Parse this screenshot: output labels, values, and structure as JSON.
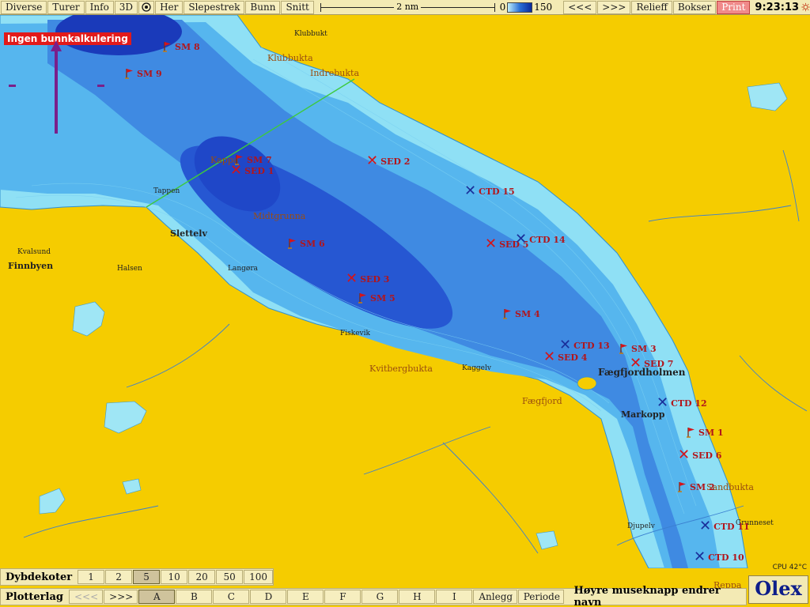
{
  "toolbar": {
    "buttons": [
      "Diverse",
      "Turer",
      "Info",
      "3D",
      "Her",
      "Slepestrek",
      "Bunn",
      "Snitt"
    ],
    "scale_label": "2 nm",
    "depth_min": "0",
    "depth_max": "150",
    "right_buttons": [
      "<<<",
      ">>>",
      "Relieff",
      "Bokser",
      "Print"
    ],
    "clock": "9:23:13"
  },
  "warning": "Ingen bunnkalkulering",
  "places": {
    "klubbukt": "Klubbukt",
    "klubbukta": "Klubbukta",
    "indrebukta": "Indrebukta",
    "tappen": "Tappen",
    "slettelv": "Slettelv",
    "kvalsund": "Kvalsund",
    "finnbyen": "Finnbyen",
    "halsen": "Halsen",
    "langora": "Langøra",
    "fiskevik": "Fiskevik",
    "kvitbergbukta": "Kvitbergbukta",
    "kaggelv": "Kaggelv",
    "faegfjord": "Fægfjord",
    "faegfjordholmen": "Fægfjordholmen",
    "markopp": "Markopp",
    "djupelv": "Djupelv",
    "sandbukta": "Sandbukta",
    "grunneset": "Grunneset",
    "reppa": "Reppa",
    "kappa": "Kappa",
    "midtgrunna": "Midtgrunna"
  },
  "stations": {
    "sm8": "SM 8",
    "sm9": "SM 9",
    "sm7": "SM 7",
    "sm6": "SM 6",
    "sm5": "SM 5",
    "sm4": "SM 4",
    "sm3": "SM 3",
    "sm1": "SM 1",
    "sm2": "SM 2",
    "sed1": "SED 1",
    "sed2": "SED 2",
    "sed3": "SED 3",
    "sed4": "SED 4",
    "sed5": "SED 5",
    "sed6": "SED 6",
    "sed7": "SED 7",
    "ctd15": "CTD 15",
    "ctd14": "CTD 14",
    "ctd13": "CTD 13",
    "ctd12": "CTD 12",
    "ctd11": "CTD 11",
    "ctd10": "CTD 10"
  },
  "cpu": "CPU 42°C",
  "logo": "Olex",
  "depth_contours": {
    "title": "Dybdekoter",
    "values": [
      "1",
      "2",
      "5",
      "10",
      "20",
      "50",
      "100"
    ],
    "selected": "5"
  },
  "plotter_layers": {
    "title": "Plotterlag",
    "prev": "<<<",
    "next": ">>>",
    "layers": [
      "A",
      "B",
      "C",
      "D",
      "E",
      "F",
      "G",
      "H",
      "I"
    ],
    "selected": "A",
    "extra": [
      "Anlegg",
      "Periode"
    ]
  },
  "hint": "Høyre museknapp endrer navn",
  "colors": {
    "land": "#f5cc00",
    "shallow_water": "#a6e6f7",
    "deep_water": "#1f47c8",
    "marker_red": "#d3141a",
    "marker_blue": "#1a2f9a"
  }
}
